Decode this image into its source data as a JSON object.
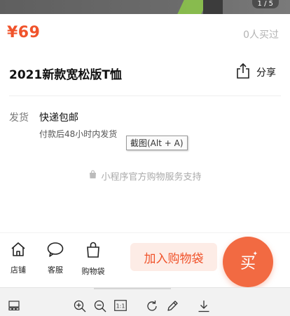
{
  "gallery": {
    "counter": "1 / 5"
  },
  "product": {
    "price": "¥69",
    "sold": "0人买过",
    "title": "2021新款宽松版T恤"
  },
  "share": {
    "label": "分享",
    "icon": "share-icon"
  },
  "shipping": {
    "label": "发货",
    "value": "快递包邮",
    "note": "付款后48小时内发货"
  },
  "tooltip": {
    "text": "截图(Alt + A)"
  },
  "support": {
    "text": "小程序官方购物服务支持",
    "icon": "shopping-bag-icon"
  },
  "bottom_nav": [
    {
      "label": "店铺",
      "icon": "store-icon"
    },
    {
      "label": "客服",
      "icon": "chat-icon"
    },
    {
      "label": "购物袋",
      "icon": "bag-icon"
    }
  ],
  "actions": {
    "add_to_cart": "加入购物袋",
    "buy": "买"
  },
  "toolbar": {
    "icons": [
      "layout-icon",
      "zoom-in-icon",
      "zoom-out-icon",
      "actual-size-icon",
      "rotate-icon",
      "edit-icon",
      "download-icon"
    ],
    "actual_size_label": "1:1"
  },
  "colors": {
    "accent": "#f0532b",
    "accent_light": "#fdece6",
    "muted": "#aaaaaa"
  }
}
